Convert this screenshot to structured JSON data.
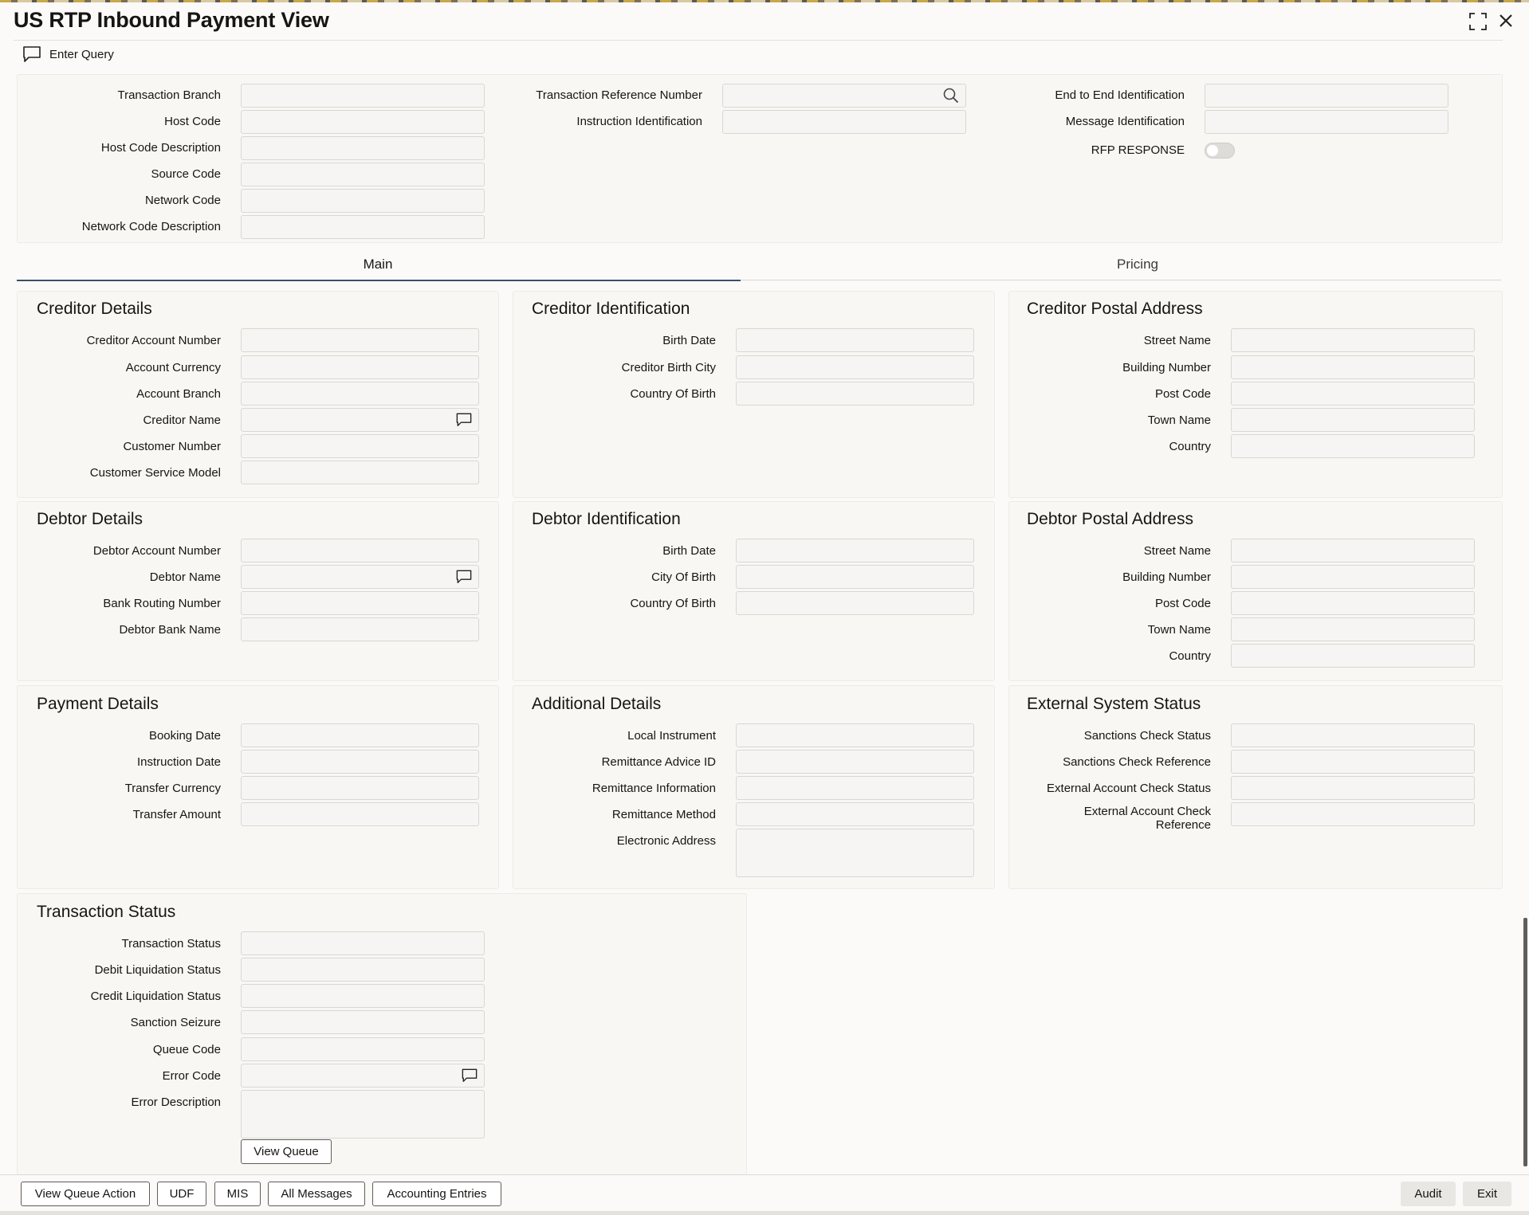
{
  "window": {
    "title": "US RTP Inbound Payment View",
    "maximize_icon": "maximize-icon",
    "close_icon": "close-icon"
  },
  "toolbar": {
    "enter_query": "Enter Query",
    "icon": "chat-icon"
  },
  "header_fields": {
    "transaction_branch": "Transaction Branch",
    "host_code": "Host Code",
    "host_code_description": "Host Code Description",
    "source_code": "Source Code",
    "network_code": "Network Code",
    "network_code_description": "Network Code Description",
    "transaction_reference_number": "Transaction Reference Number",
    "instruction_identification": "Instruction Identification",
    "end_to_end_identification": "End to End Identification",
    "message_identification": "Message Identification",
    "rfp_response": "RFP RESPONSE"
  },
  "tabs": [
    {
      "label": "Main",
      "active": true
    },
    {
      "label": "Pricing",
      "active": false
    }
  ],
  "sections": {
    "creditor_details": {
      "title": "Creditor Details",
      "fields": [
        "Creditor Account Number",
        "Account Currency",
        "Account Branch",
        "Creditor Name",
        "Customer Number",
        "Customer Service Model"
      ]
    },
    "creditor_identification": {
      "title": "Creditor Identification",
      "fields": [
        "Birth Date",
        "Creditor Birth City",
        "Country Of Birth"
      ]
    },
    "creditor_postal_address": {
      "title": "Creditor Postal Address",
      "fields": [
        "Street Name",
        "Building Number",
        "Post Code",
        "Town Name",
        "Country"
      ]
    },
    "debtor_details": {
      "title": "Debtor Details",
      "fields": [
        "Debtor Account Number",
        "Debtor Name",
        "Bank Routing Number",
        "Debtor Bank Name"
      ]
    },
    "debtor_identification": {
      "title": "Debtor Identification",
      "fields": [
        "Birth Date",
        "City Of Birth",
        "Country Of Birth"
      ]
    },
    "debtor_postal_address": {
      "title": "Debtor Postal Address",
      "fields": [
        "Street Name",
        "Building Number",
        "Post Code",
        "Town Name",
        "Country"
      ]
    },
    "payment_details": {
      "title": "Payment Details",
      "fields": [
        "Booking Date",
        "Instruction Date",
        "Transfer Currency",
        "Transfer Amount"
      ]
    },
    "additional_details": {
      "title": "Additional Details",
      "fields": [
        "Local Instrument",
        "Remittance Advice ID",
        "Remittance Information",
        "Remittance Method",
        "Electronic Address"
      ]
    },
    "external_system_status": {
      "title": "External System Status",
      "fields": [
        "Sanctions Check Status",
        "Sanctions Check Reference",
        "External Account Check Status",
        "External Account Check Reference"
      ]
    },
    "transaction_status": {
      "title": "Transaction Status",
      "fields": [
        "Transaction Status",
        "Debit Liquidation Status",
        "Credit Liquidation Status",
        "Sanction Seizure",
        "Queue Code",
        "Error Code",
        "Error Description"
      ],
      "view_queue": "View Queue"
    }
  },
  "footer": {
    "buttons": [
      "View Queue Action",
      "UDF",
      "MIS",
      "All Messages",
      "Accounting Entries"
    ],
    "audit": "Audit",
    "exit": "Exit"
  },
  "colors": {
    "tab_active_line": "#3d4f6e",
    "tab_inactive_line": "#d8d6d1"
  }
}
